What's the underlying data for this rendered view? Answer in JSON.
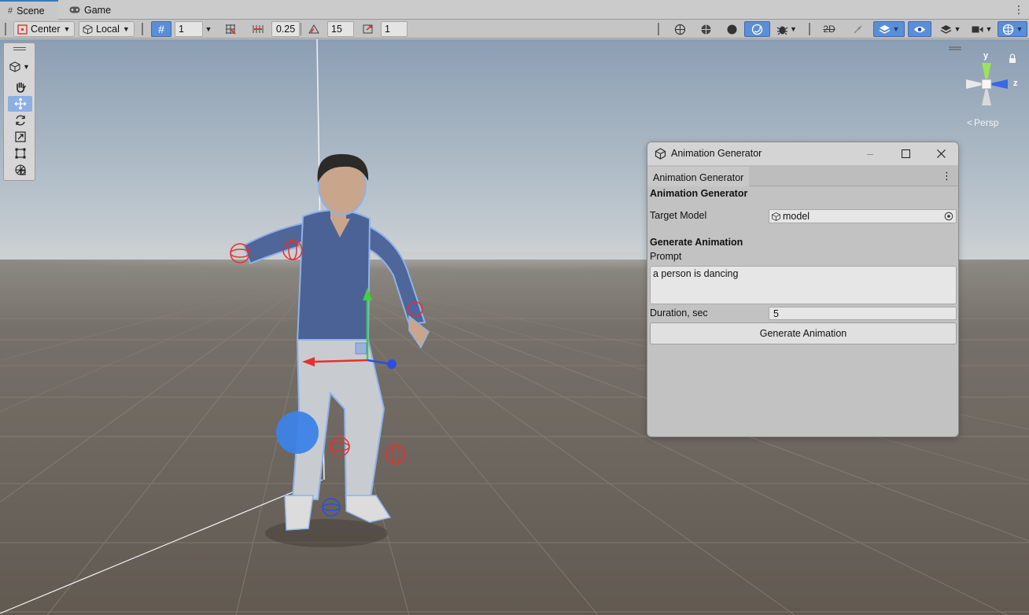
{
  "tabs": [
    {
      "label": "Scene",
      "icon": "hash-icon",
      "active": true
    },
    {
      "label": "Game",
      "icon": "gamepad-icon",
      "active": false
    }
  ],
  "toolbar": {
    "pivot_mode": "Center",
    "pivot_rotation": "Local",
    "grid_size": "1",
    "move_snap": "0.25",
    "rotate_snap": "15",
    "scale_snap": "1"
  },
  "gizmo": {
    "y_label": "y",
    "z_label": "z",
    "projection": "Persp"
  },
  "window": {
    "title": "Animation Generator",
    "tab_label": "Animation Generator",
    "section_header": "Animation Generator",
    "target_model_label": "Target Model",
    "target_model_value": "model",
    "generate_section": "Generate Animation",
    "prompt_label": "Prompt",
    "prompt_value": "a person is dancing",
    "duration_label": "Duration, sec",
    "duration_value": "5",
    "generate_button": "Generate Animation"
  },
  "colors": {
    "accent": "#5b8ed4",
    "sky_top": "#8aa0b4",
    "floor": "#6b6358"
  }
}
